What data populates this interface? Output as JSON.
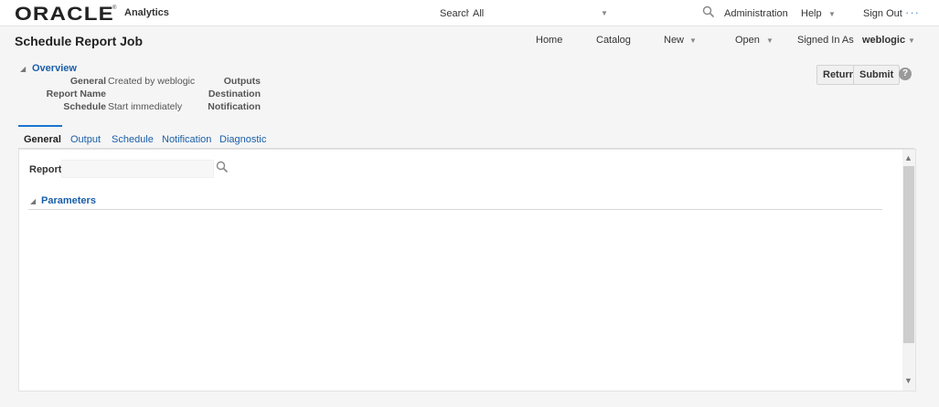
{
  "brand": {
    "logo_text": "ORACLE",
    "logo_mark": "®",
    "app_name": "Analytics"
  },
  "topbar": {
    "search_label": "Search",
    "search_scope": "All",
    "search_query": "",
    "admin_link": "Administration",
    "help_link": "Help",
    "signout_link": "Sign Out",
    "more_dots": "···"
  },
  "header": {
    "title": "Schedule Report Job",
    "nav": {
      "home": "Home",
      "catalog": "Catalog",
      "new": "New",
      "open": "Open",
      "signed_in_as": "Signed In As",
      "user": "weblogic"
    }
  },
  "overview": {
    "title": "Overview",
    "general_label": "General",
    "general_value": "Created by weblogic",
    "report_name_label": "Report Name",
    "report_name_value": "",
    "schedule_label": "Schedule",
    "schedule_value": "Start immediately",
    "outputs_label": "Outputs",
    "destination_label": "Destination",
    "notification_label": "Notification"
  },
  "actions": {
    "return": "Return",
    "submit": "Submit",
    "help": "?"
  },
  "tabs": {
    "general": "General",
    "output": "Output",
    "schedule": "Schedule",
    "notification": "Notification",
    "diagnostic": "Diagnostic",
    "active": "General"
  },
  "general_panel": {
    "report_label": "Report",
    "report_value": "",
    "parameters_title": "Parameters"
  },
  "colors": {
    "link_blue": "#1a5ea8",
    "tab_accent": "#1a75cf",
    "background": "#f5f5f5"
  },
  "icons": {
    "search": "search-icon",
    "dropdown": "chevron-down-icon",
    "collapse": "triangle-collapse-icon",
    "help": "help-icon"
  }
}
